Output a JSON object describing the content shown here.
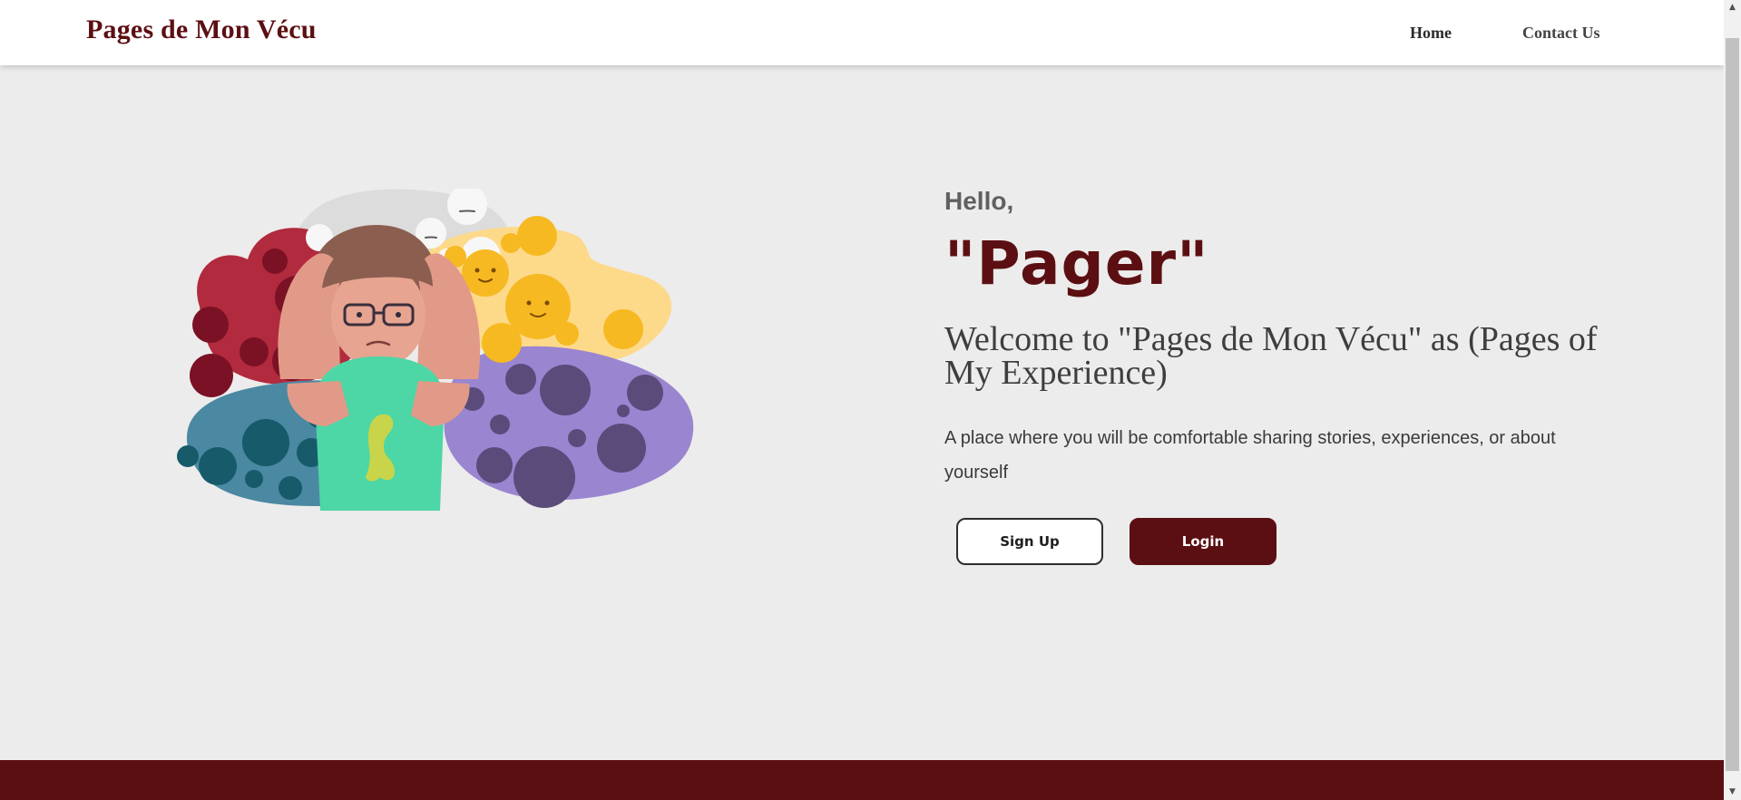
{
  "header": {
    "brand": "Pages de Mon Vécu",
    "nav": {
      "home": "Home",
      "contact": "Contact Us"
    }
  },
  "hero": {
    "greeting": "Hello,",
    "name": "\"Pager\"",
    "welcome": "Welcome to \"Pages de Mon Vécu\" as (Pages of My Experience)",
    "tagline": "A place where you will be comfortable sharing stories, experiences, or about yourself",
    "buttons": {
      "signup": "Sign Up",
      "login": "Login"
    }
  },
  "colors": {
    "brand": "#5c0f12",
    "background": "#ececec",
    "navbar": "#ffffff",
    "footer": "#5c0f12"
  },
  "icons": {
    "scroll_up": "▲",
    "scroll_down": "▼"
  }
}
